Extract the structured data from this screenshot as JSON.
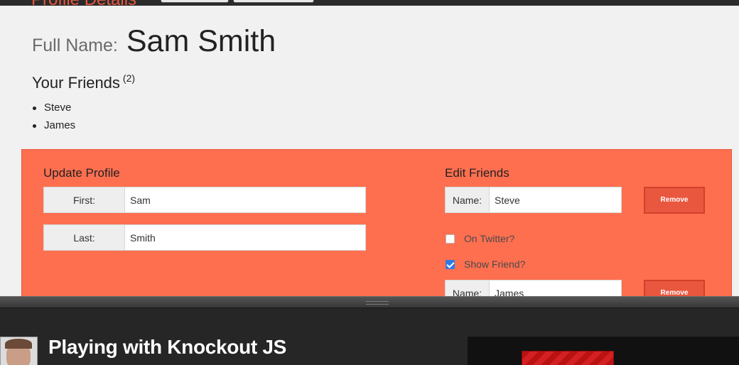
{
  "header": {
    "title_partial": "Profile Details"
  },
  "profile": {
    "full_name_label": "Full Name:",
    "full_name": "Sam Smith",
    "friends_heading": "Your Friends",
    "friends_count": "(2)",
    "friends": [
      "Steve",
      "James"
    ]
  },
  "update_profile": {
    "heading": "Update Profile",
    "first_label": "First:",
    "first_value": "Sam",
    "last_label": "Last:",
    "last_value": "Smith"
  },
  "edit_friends": {
    "heading": "Edit Friends",
    "name_label": "Name:",
    "remove_label": "Remove",
    "friends": [
      {
        "name": "Steve",
        "on_twitter_label": "On Twitter?",
        "on_twitter": false,
        "show_friend_label": "Show Friend?",
        "show_friend": true
      },
      {
        "name": "James"
      }
    ]
  },
  "video": {
    "title": "Playing with Knockout JS"
  },
  "colors": {
    "panel": "#fe6f50",
    "accent": "#e9573f",
    "checkbox": "#2f7ae5"
  }
}
